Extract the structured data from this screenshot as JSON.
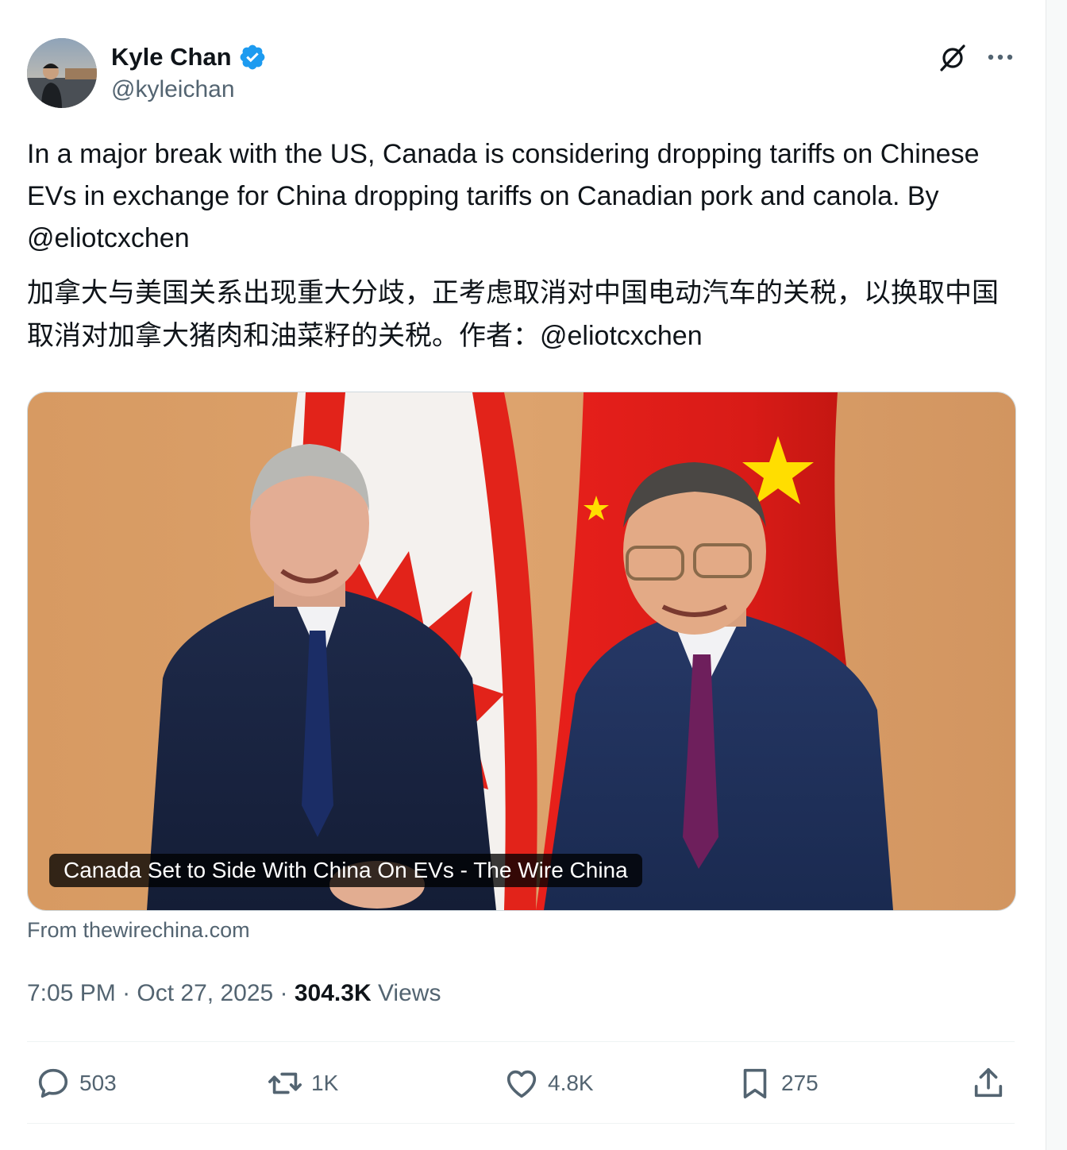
{
  "tweet": {
    "author": {
      "name": "Kyle Chan",
      "handle": "@kyleichan",
      "verified": true
    },
    "text_en_prefix": "In a major break with the US, Canada is considering dropping tariffs on Chinese EVs in exchange for China dropping tariffs on Canadian pork and canola. By ",
    "text_en_mention": "@eliotcxchen",
    "text_zh_prefix": "加拿大与美国关系出现重大分歧，正考虑取消对中国电动汽车的关税，以换取中国取消对加拿大猪肉和油菜籽的关税。作者：",
    "text_zh_mention": "@eliotcxchen",
    "card": {
      "title": "Canada Set to Side With China On EVs - The Wire China",
      "source": "From thewirechina.com"
    },
    "time": "7:05 PM",
    "date": "Oct 27, 2025",
    "views_count": "304.3K",
    "views_label": "Views",
    "stats": {
      "replies": "503",
      "reposts": "1K",
      "likes": "4.8K",
      "bookmarks": "275"
    }
  },
  "icons": {
    "verified": "verified-badge-icon",
    "grok": "grok-icon",
    "more": "more-icon",
    "reply": "reply-icon",
    "repost": "repost-icon",
    "like": "like-icon",
    "bookmark": "bookmark-icon",
    "share": "share-icon"
  },
  "colors": {
    "verified_blue": "#1d9bf0",
    "text_primary": "#0f1419",
    "text_secondary": "#536471"
  }
}
